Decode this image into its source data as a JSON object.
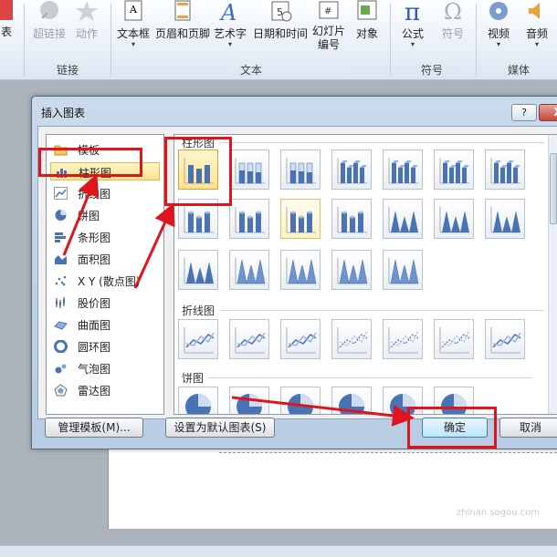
{
  "ribbon": {
    "buttons": [
      {
        "label": "表"
      },
      {
        "label": "超链接"
      },
      {
        "label": "动作"
      },
      {
        "label": "文本框"
      },
      {
        "label": "页眉和页脚"
      },
      {
        "label": "艺术字"
      },
      {
        "label": "日期和时间"
      },
      {
        "label": "幻灯片",
        "label2": "编号"
      },
      {
        "label": "对象"
      },
      {
        "label": "公式"
      },
      {
        "label": "符号"
      },
      {
        "label": "视频"
      },
      {
        "label": "音频"
      }
    ],
    "groups": {
      "links": "链接",
      "text": "文本",
      "symbols": "符号",
      "media": "媒体"
    }
  },
  "dialog": {
    "title": "插入图表",
    "help_label": "?",
    "close_label": "X",
    "categories": [
      {
        "label": "模板",
        "icon": "folder-icon"
      },
      {
        "label": "柱形图",
        "icon": "column-chart-icon",
        "selected": true
      },
      {
        "label": "折线图",
        "icon": "line-chart-icon"
      },
      {
        "label": "饼图",
        "icon": "pie-chart-icon"
      },
      {
        "label": "条形图",
        "icon": "bar-chart-icon"
      },
      {
        "label": "面积图",
        "icon": "area-chart-icon"
      },
      {
        "label": "X Y (散点图)",
        "icon": "scatter-chart-icon"
      },
      {
        "label": "股价图",
        "icon": "stock-chart-icon"
      },
      {
        "label": "曲面图",
        "icon": "surface-chart-icon"
      },
      {
        "label": "圆环图",
        "icon": "doughnut-chart-icon"
      },
      {
        "label": "气泡图",
        "icon": "bubble-chart-icon"
      },
      {
        "label": "雷达图",
        "icon": "radar-chart-icon"
      }
    ],
    "sections": {
      "column": "柱形图",
      "line": "折线图",
      "pie": "饼图"
    },
    "buttons": {
      "manage_templates": "管理模板(M)...",
      "set_default": "设置为默认图表(S)",
      "ok": "确定",
      "cancel": "取消"
    }
  },
  "colors": {
    "annotation": "#e0141c",
    "selection": "#ffe38a",
    "bar": "#4a73b5"
  }
}
